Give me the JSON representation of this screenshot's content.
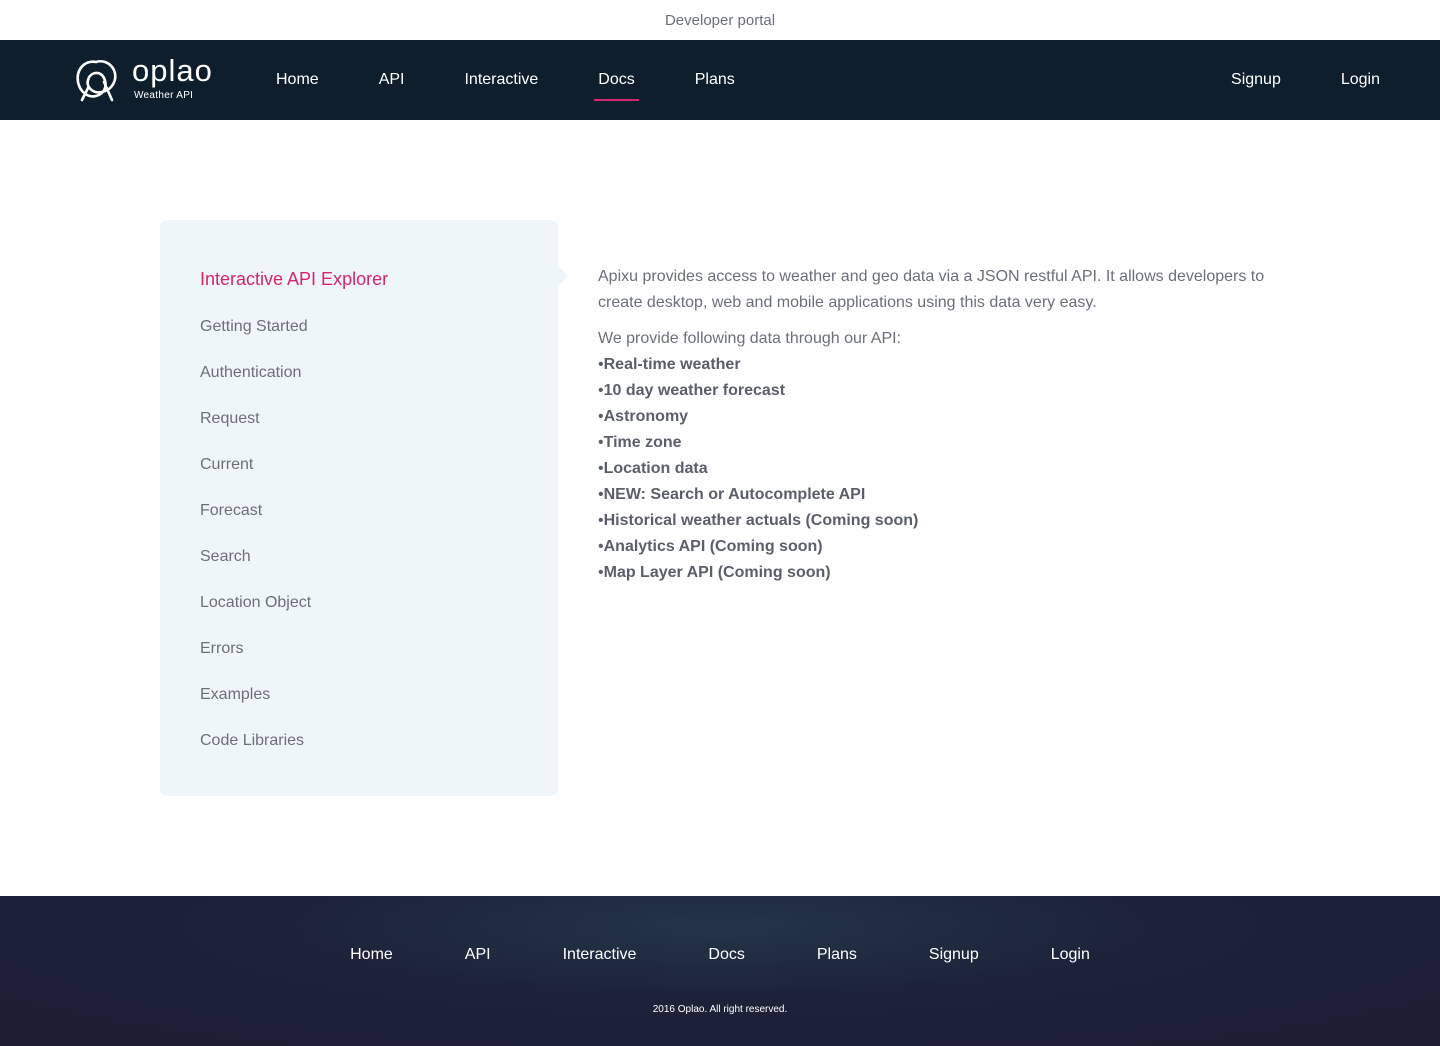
{
  "topbar": {
    "title": "Developer portal"
  },
  "logo": {
    "name": "oplao",
    "subtitle": "Weather API"
  },
  "nav": {
    "left": [
      "Home",
      "API",
      "Interactive",
      "Docs",
      "Plans"
    ],
    "right": [
      "Signup",
      "Login"
    ],
    "active": "Docs"
  },
  "sidebar": {
    "title": "Interactive API Explorer",
    "items": [
      "Getting Started",
      "Authentication",
      "Request",
      "Current",
      "Forecast",
      "Search",
      "Location Object",
      "Errors",
      "Examples",
      "Code Libraries"
    ]
  },
  "main": {
    "intro": "Apixu provides access to weather and geo data via a JSON restful API. It allows developers to create desktop, web and mobile applications using this data very easy.",
    "list_intro": "We provide following data through our API:",
    "features": [
      "Real-time weather",
      "10 day weather forecast",
      "Astronomy",
      "Time zone",
      "Location data",
      "NEW: Search or Autocomplete API",
      "Historical weather actuals (Coming soon)",
      "Analytics API (Coming soon)",
      "Map Layer API (Coming soon)"
    ]
  },
  "footer": {
    "nav": [
      "Home",
      "API",
      "Interactive",
      "Docs",
      "Plans",
      "Signup",
      "Login"
    ],
    "copyright": "2016 Oplao. All right reserved."
  },
  "colors": {
    "navbar": "#0e1e2c",
    "accent": "#d6246e",
    "sidebar_bg": "#eff6fa",
    "text": "#6b6f7a",
    "footer": "#1d1d33"
  }
}
